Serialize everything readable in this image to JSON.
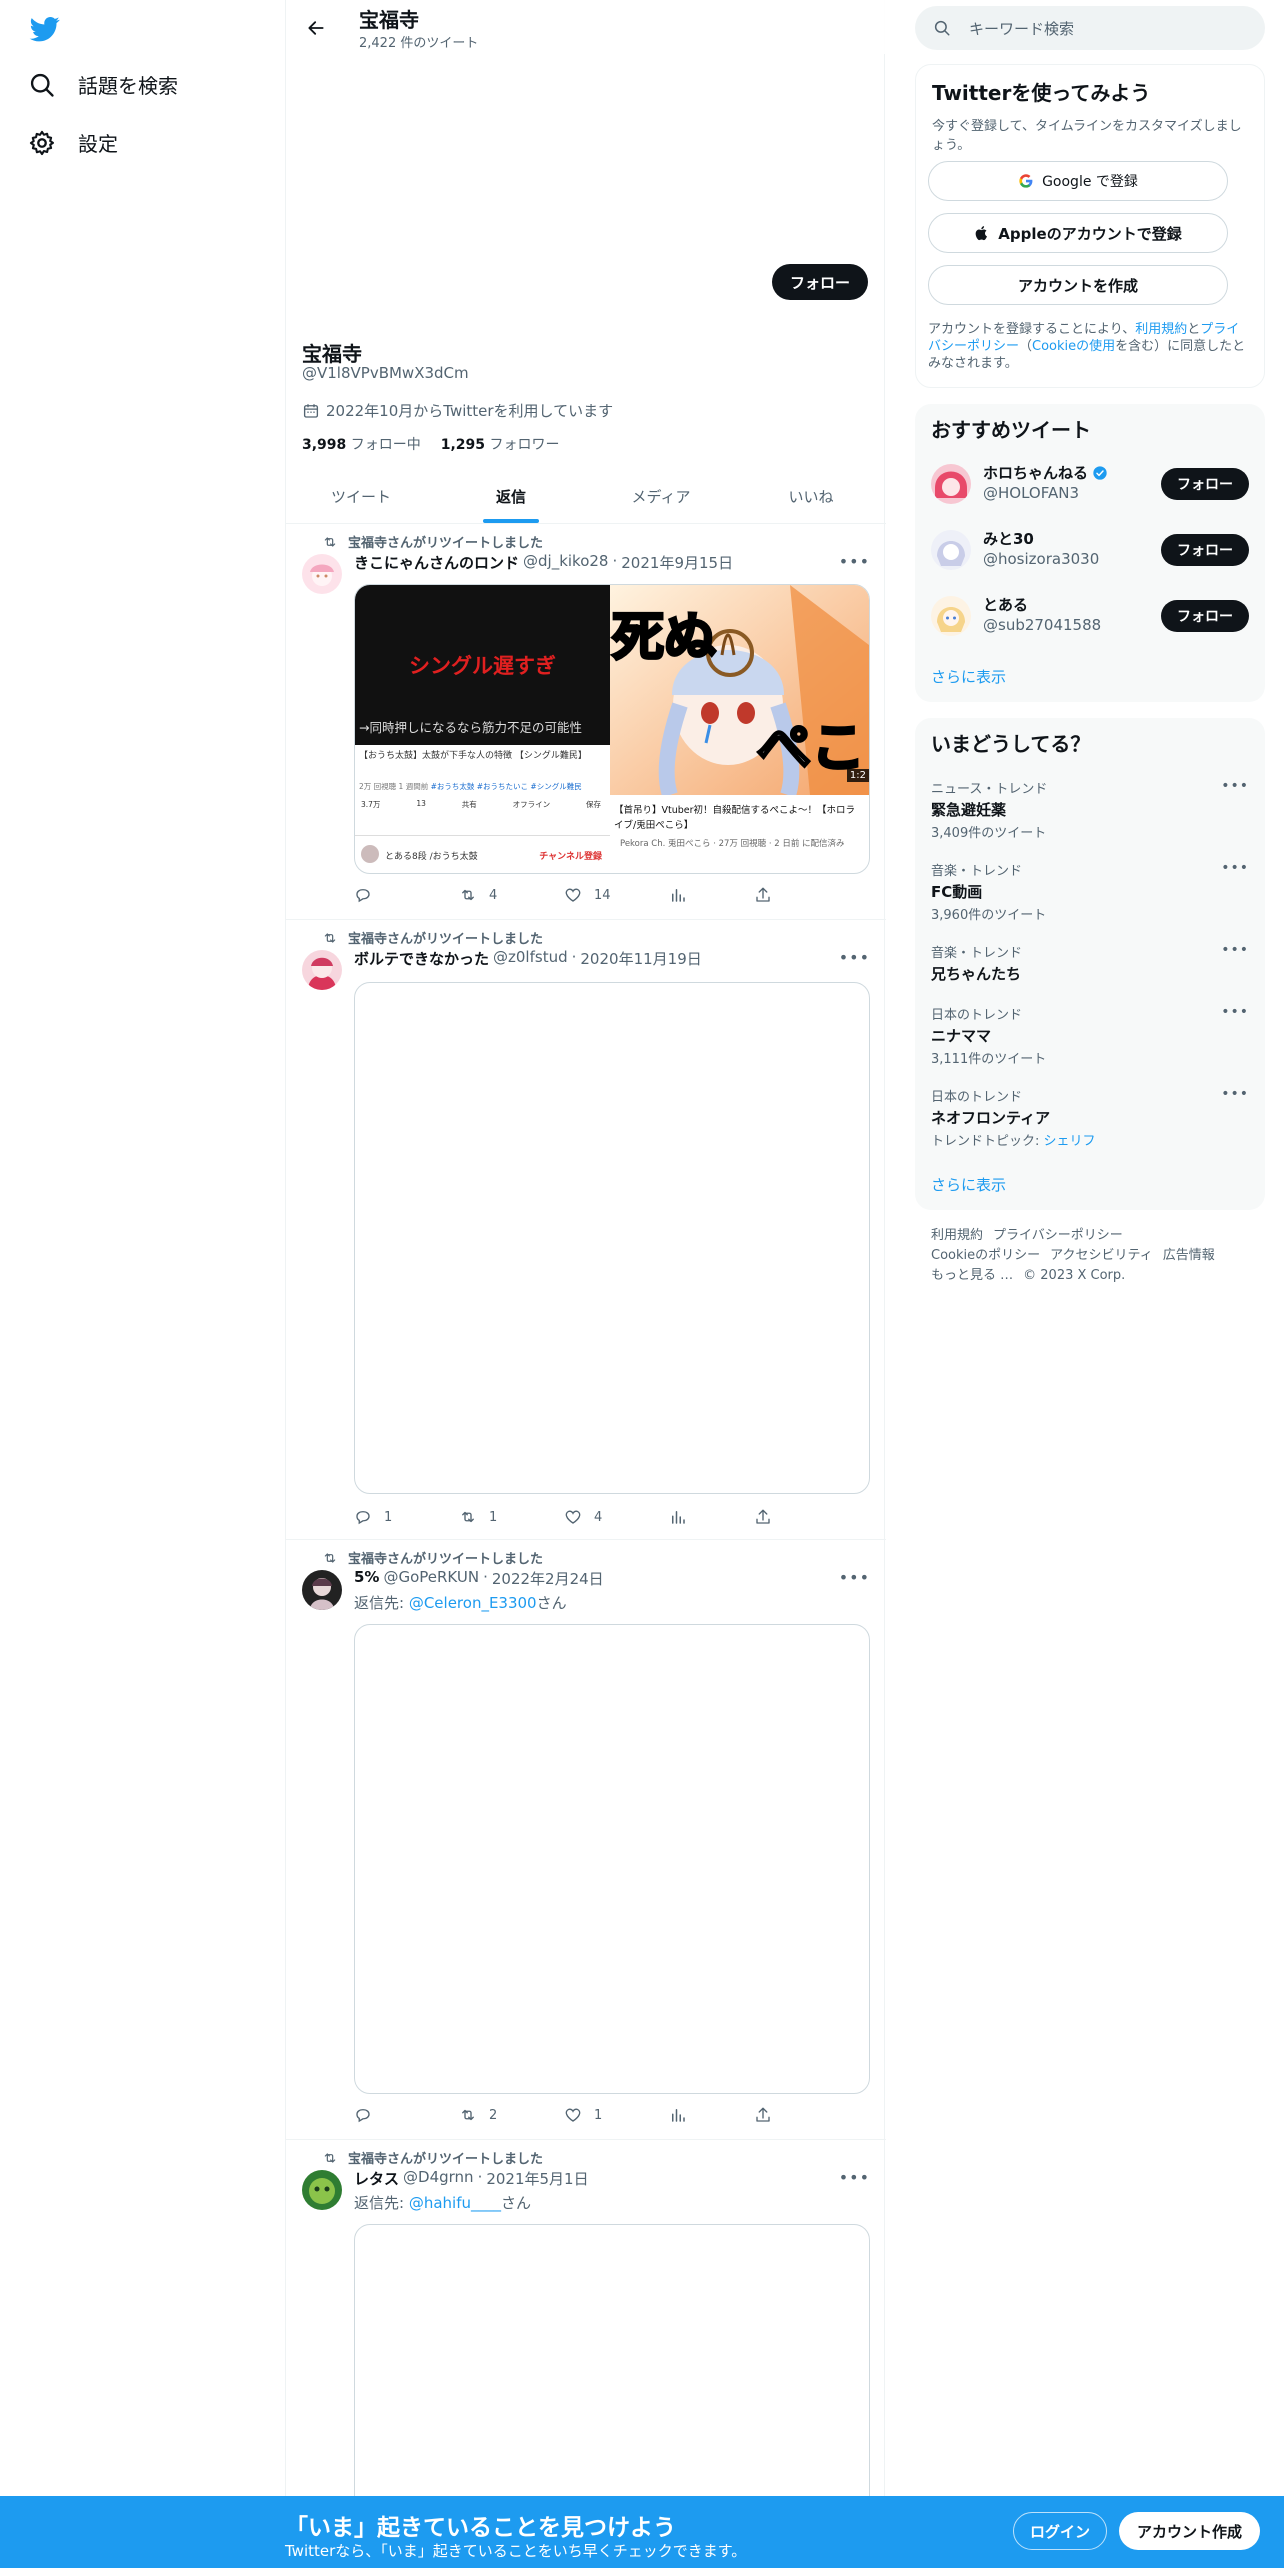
{
  "nav": {
    "explore_label": "話題を検索",
    "settings_label": "設定"
  },
  "header": {
    "title": "宝福寺",
    "tweet_count": "2,422 件のツイート"
  },
  "profile": {
    "follow_label": "フォロー",
    "name": "宝福寺",
    "handle": "@V1l8VPvBMwX3dCm",
    "joined": "2022年10月からTwitterを利用しています",
    "following_count": "3,998",
    "following_label": "フォロー中",
    "followers_count": "1,295",
    "followers_label": "フォロワー"
  },
  "tabs": [
    "ツイート",
    "返信",
    "メディア",
    "いいね"
  ],
  "active_tab": "返信",
  "tweets": [
    {
      "retweet_text": "宝福寺さんがリツイートしました",
      "name": "きこにゃんさんのロンド",
      "handle": "@dj_kiko28",
      "date": "2021年9月15日",
      "reply": "",
      "replies": "",
      "retweets": "4",
      "likes": "14",
      "media_left": {
        "overlay": "シングル遅すぎ",
        "caption": "→同時押しになるなら筋力不足の可能性",
        "title": "【おうち太鼓】太鼓が下手な人の特徴 【シングル難民】",
        "meta": "2万 回視聴 1 週間前",
        "tags": "#おうち太鼓 #おうちたいこ #シングル難民",
        "buttons": [
          "3.7万",
          "13",
          "共有",
          "オフライン",
          "保存"
        ],
        "channel": "とある8段 /おうち太鼓",
        "subscribe": "チャンネル登録"
      },
      "media_right": {
        "overlay_top": "死ぬ",
        "overlay_bottom": "ぺこ",
        "duration": "1:2",
        "title": "【首吊り】Vtuber初！自殺配信するぺこよ～！【ホロライブ/兎田ぺこら】",
        "meta": "Pekora Ch. 兎田ぺこら · 27万 回視聴 · 2 日前 に配信済み"
      }
    },
    {
      "retweet_text": "宝福寺さんがリツイートしました",
      "name": "ボルテできなかった",
      "handle": "@z0lfstud",
      "date": "2020年11月19日",
      "reply": "",
      "replies": "1",
      "retweets": "1",
      "likes": "4"
    },
    {
      "retweet_text": "宝福寺さんがリツイートしました",
      "name": "5%",
      "handle": "@GoPeRKUN",
      "date": "2022年2月24日",
      "reply_prefix": "返信先: ",
      "reply_user": "@Celeron_E3300",
      "reply_suffix": "さん",
      "replies": "",
      "retweets": "2",
      "likes": "1"
    },
    {
      "retweet_text": "宝福寺さんがリツイートしました",
      "name": "レタス",
      "handle": "@D4grnn",
      "date": "2021年5月1日",
      "reply_prefix": "返信先: ",
      "reply_user": "@hahifu____",
      "reply_suffix": "さん"
    }
  ],
  "search": {
    "placeholder": "キーワード検索"
  },
  "signup": {
    "title": "Twitterを使ってみよう",
    "subtitle": "今すぐ登録して、タイムラインをカスタマイズしましょう。",
    "google": "Google で登録",
    "apple": "Appleのアカウントで登録",
    "create": "アカウントを作成",
    "terms_1": "アカウントを登録することにより、",
    "terms_link1": "利用規約",
    "terms_2": "と",
    "terms_link2": "プライバシーポリシー",
    "terms_3": "（",
    "terms_link3": "Cookieの使用",
    "terms_4": "を含む）に同意したとみなされます。"
  },
  "recommend": {
    "title": "おすすめツイート",
    "items": [
      {
        "name": "ホロちゃんねる",
        "handle": "@HOLOFAN3",
        "verified": true,
        "follow": "フォロー"
      },
      {
        "name": "みと30",
        "handle": "@hosizora3030",
        "verified": false,
        "follow": "フォロー"
      },
      {
        "name": "とある",
        "handle": "@sub27041588",
        "verified": false,
        "follow": "フォロー"
      }
    ],
    "more": "さらに表示"
  },
  "trends": {
    "title": "いまどうしてる？",
    "items": [
      {
        "context": "ニュース・トレンド",
        "topic": "緊急避妊薬",
        "count": "3,409件のツイート"
      },
      {
        "context": "音楽・トレンド",
        "topic": "FC動画",
        "count": "3,960件のツイート"
      },
      {
        "context": "音楽・トレンド",
        "topic": "兄ちゃんたち",
        "count": ""
      },
      {
        "context": "日本のトレンド",
        "topic": "ニナママ",
        "count": "3,111件のツイート"
      },
      {
        "context": "日本のトレンド",
        "topic": "ネオフロンティア",
        "count_prefix": "トレンドトピック: ",
        "count_link": "シェリフ"
      }
    ],
    "more": "さらに表示"
  },
  "footer": {
    "links": [
      "利用規約",
      "プライバシーポリシー",
      "Cookieのポリシー",
      "アクセシビリティ",
      "広告情報",
      "もっと見る …",
      "© 2023 X Corp."
    ]
  },
  "bottom": {
    "title": "「いま」起きていることを見つけよう",
    "subtitle": "Twitterなら、「いま」起きていることをいち早くチェックできます。",
    "login": "ログイン",
    "signup": "アカウント作成"
  },
  "colors": {
    "accent": "#1d9bf0",
    "text": "#0f1419",
    "muted": "#536471"
  }
}
